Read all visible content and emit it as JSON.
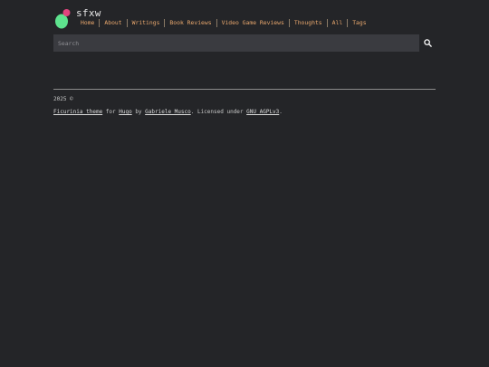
{
  "site": {
    "title": "sfxw"
  },
  "nav": {
    "items": [
      {
        "label": "Home"
      },
      {
        "label": "About"
      },
      {
        "label": "Writings"
      },
      {
        "label": "Book Reviews"
      },
      {
        "label": "Video Game Reviews"
      },
      {
        "label": "Thoughts"
      },
      {
        "label": "All"
      },
      {
        "label": "Tags"
      }
    ]
  },
  "search": {
    "placeholder": "Search",
    "icon": "search-icon"
  },
  "footer": {
    "copyright": "2025 ©",
    "theme_link": "Ficurinia theme",
    "for": " for ",
    "hugo_link": "Hugo",
    "by": " by ",
    "author_link": "Gabriele Musco",
    "licensed": ". Licensed under ",
    "license_link": "GNU AGPLv3",
    "end": "."
  },
  "colors": {
    "background": "#242528",
    "nav_link": "#e8a76d",
    "logo_green": "#5ee38e",
    "logo_pink": "#e0447e"
  }
}
